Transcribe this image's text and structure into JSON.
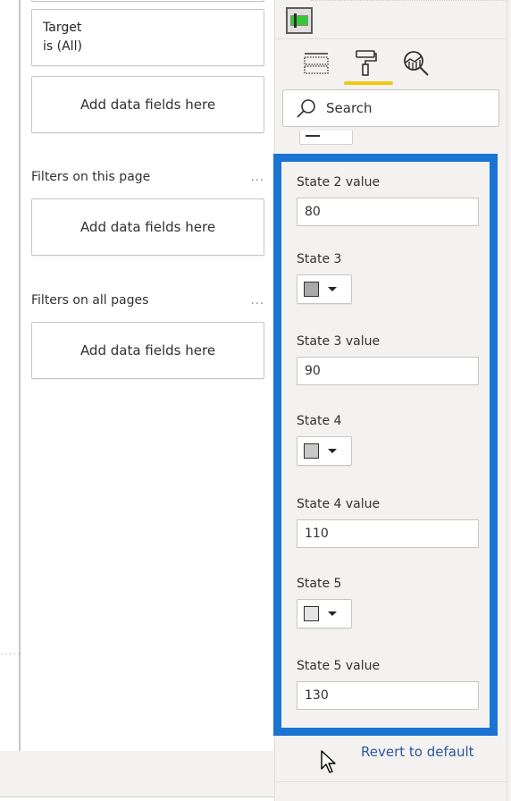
{
  "filters_pane": {
    "target_filter": {
      "field": "Target",
      "condition": "is (All)"
    },
    "visual_dropzone": "Add data fields here",
    "page_section": {
      "title": "Filters on this page",
      "more": "...",
      "dropzone": "Add data fields here"
    },
    "all_pages_section": {
      "title": "Filters on all pages",
      "more": "...",
      "dropzone": "Add data fields here"
    }
  },
  "canvas": {
    "dots": "....."
  },
  "viz_pane": {
    "tabs": [
      {
        "name": "fields",
        "icon": "fields-icon",
        "active": false
      },
      {
        "name": "format",
        "icon": "paint-roller-icon",
        "active": true
      },
      {
        "name": "analytics",
        "icon": "analytics-magnifier-icon",
        "active": false
      }
    ],
    "search": {
      "placeholder": "Search",
      "value": ""
    },
    "properties": [
      {
        "label": "State 2 value",
        "type": "input",
        "value": "80"
      },
      {
        "label": "State 3",
        "type": "color",
        "color": "#a8a8a8"
      },
      {
        "label": "State 3 value",
        "type": "input",
        "value": "90"
      },
      {
        "label": "State 4",
        "type": "color",
        "color": "#c8c8c8"
      },
      {
        "label": "State 4 value",
        "type": "input",
        "value": "110"
      },
      {
        "label": "State 5",
        "type": "color",
        "color": "#e4e4e4"
      },
      {
        "label": "State 5 value",
        "type": "input",
        "value": "130"
      }
    ],
    "revert_label": "Revert to default",
    "accent_color": "#f2c811",
    "highlight_color": "#1b74d2"
  }
}
